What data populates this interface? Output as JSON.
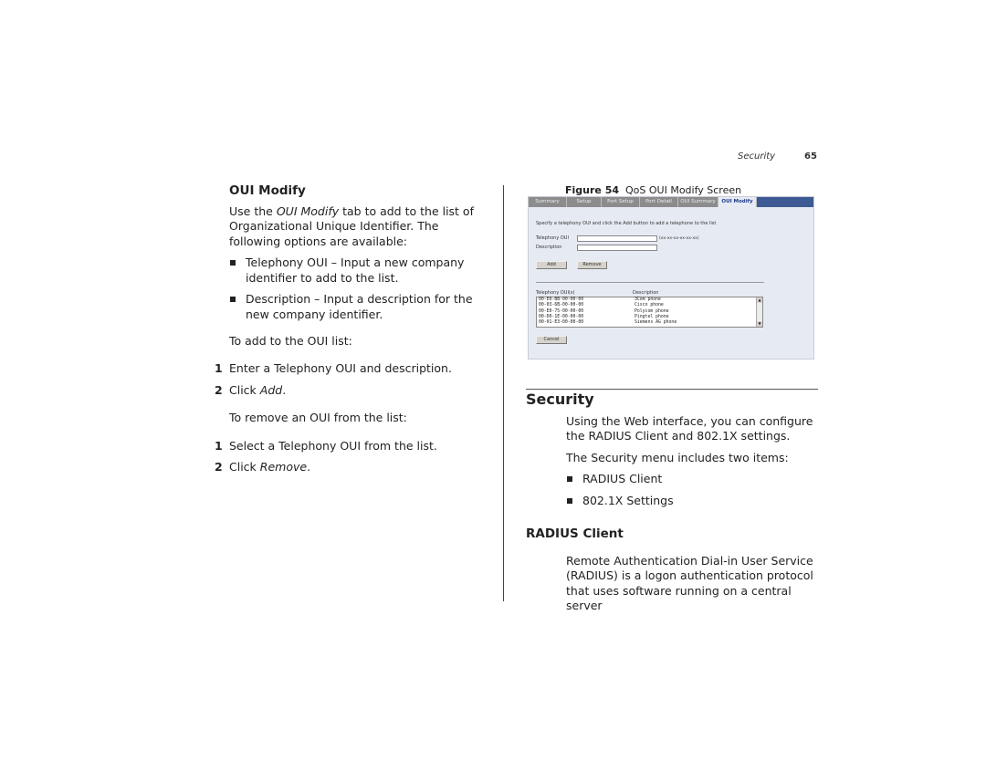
{
  "header": {
    "section": "Security",
    "page": "65"
  },
  "left": {
    "heading": "OUI Modify",
    "intro_pre": "Use the ",
    "intro_em": "OUI Modify",
    "intro_post": " tab to add to the list of Organizational Unique Identifier. The following options are available:",
    "bullets": [
      "Telephony OUI – Input a new company identifier to add to the list.",
      "Description – Input a description for the new company identifier."
    ],
    "add_lead": "To add to the OUI list:",
    "add_steps": [
      {
        "n": "1",
        "pre": "Enter a Telephony OUI and description.",
        "em": ""
      },
      {
        "n": "2",
        "pre": "Click ",
        "em": "Add",
        "post": "."
      }
    ],
    "remove_lead": "To remove an OUI from the list:",
    "remove_steps": [
      {
        "n": "1",
        "pre": "Select a Telephony OUI from the list.",
        "em": ""
      },
      {
        "n": "2",
        "pre": "Click ",
        "em": "Remove",
        "post": "."
      }
    ]
  },
  "figure": {
    "label": "Figure 54",
    "caption": "QoS OUI Modify Screen",
    "tabs": [
      "Summary",
      "Setup",
      "Port Setup",
      "Port Detail",
      "OUI Summary",
      "OUI Modify"
    ],
    "active_tab": "OUI Modify",
    "instruction": "Specify a telephony OUI and click the Add button to add a telephone to the list",
    "oui_label": "Telephony OUI",
    "oui_value": "",
    "oui_hint": "(xx-xx-xx-xx-xx-xx)",
    "desc_label": "Description",
    "desc_value": "",
    "add_button": "Add",
    "remove_button": "Remove",
    "list_header_oui": "Telephony OUI(s)",
    "list_header_desc": "Description",
    "list_rows": [
      {
        "oui": "00-E0-BB-00-00-00",
        "desc": "3Com phone"
      },
      {
        "oui": "00-03-6B-00-00-00",
        "desc": "Cisco phone"
      },
      {
        "oui": "00-E0-75-00-00-00",
        "desc": "Polycom phone"
      },
      {
        "oui": "00-D0-1E-00-00-00",
        "desc": "Pingtel phone"
      },
      {
        "oui": "00-01-E3-00-00-00",
        "desc": "Siemens AG phone"
      }
    ],
    "cancel_button": "Cancel"
  },
  "right": {
    "section_title": "Security",
    "intro": "Using the Web interface, you can configure the RADIUS Client and 802.1X settings.",
    "menu_lead": "The Security menu includes two items:",
    "menu_items": [
      "RADIUS Client",
      "802.1X Settings"
    ],
    "sub_heading": "RADIUS Client",
    "radius_text": "Remote Authentication Dial-in User Service (RADIUS) is a logon authentication protocol that uses software running on a central server"
  }
}
